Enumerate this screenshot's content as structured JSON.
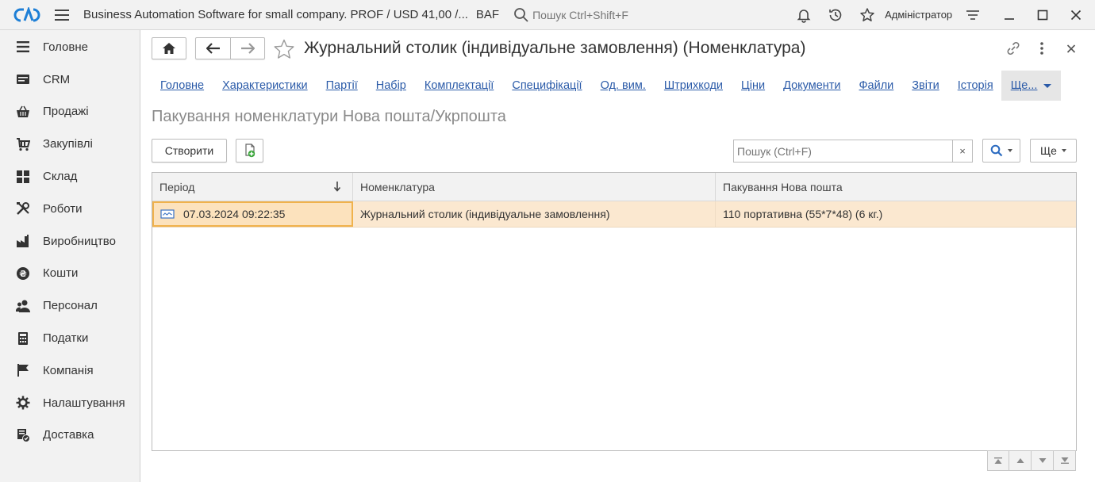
{
  "topbar": {
    "title": "Business Automation Software for small company. PROF / USD 41,00 /...",
    "suffix": "BAF",
    "search_placeholder": "Пошук Ctrl+Shift+F",
    "user": "Адміністратор"
  },
  "sidebar": {
    "items": [
      {
        "label": "Головне",
        "icon": "menu-lines-icon"
      },
      {
        "label": "CRM",
        "icon": "crm-icon"
      },
      {
        "label": "Продажі",
        "icon": "basket-icon"
      },
      {
        "label": "Закупівлі",
        "icon": "cart-icon"
      },
      {
        "label": "Склад",
        "icon": "warehouse-icon"
      },
      {
        "label": "Роботи",
        "icon": "tools-icon"
      },
      {
        "label": "Виробництво",
        "icon": "factory-icon"
      },
      {
        "label": "Кошти",
        "icon": "money-icon"
      },
      {
        "label": "Персонал",
        "icon": "people-icon"
      },
      {
        "label": "Податки",
        "icon": "calculator-icon"
      },
      {
        "label": "Компанія",
        "icon": "flag-icon"
      },
      {
        "label": "Налаштування",
        "icon": "gear-icon"
      },
      {
        "label": "Доставка",
        "icon": "delivery-icon"
      }
    ]
  },
  "form": {
    "title": "Журнальний столик (індивідуальне замовлення) (Номенклатура)",
    "tabs": [
      "Головне",
      "Характеристики",
      "Партії",
      "Набір",
      "Комплектації",
      "Специфікації",
      "Од. вим.",
      "Штрихкоди",
      "Ціни",
      "Документи",
      "Файли",
      "Звіти",
      "Історія"
    ],
    "tab_more": "Ще...",
    "section_title": "Пакування номенклатури Нова пошта/Укрпошта",
    "create_label": "Створити",
    "search_placeholder": "Пошук (Ctrl+F)",
    "clear_label": "×",
    "more_label": "Ще"
  },
  "table": {
    "columns": [
      "Період",
      "Номенклатура",
      "Пакування Нова пошта"
    ],
    "rows": [
      {
        "period": "07.03.2024 09:22:35",
        "item": "Журнальний столик (індивідуальне замовлення)",
        "packing": "110 портативна (55*7*48) (6 кг.)"
      }
    ]
  },
  "colors": {
    "accent": "#2a5aa8",
    "selected_row": "#fbe8d0",
    "selected_cell_border": "#f0b24c",
    "logo": "#1e7fd6"
  }
}
